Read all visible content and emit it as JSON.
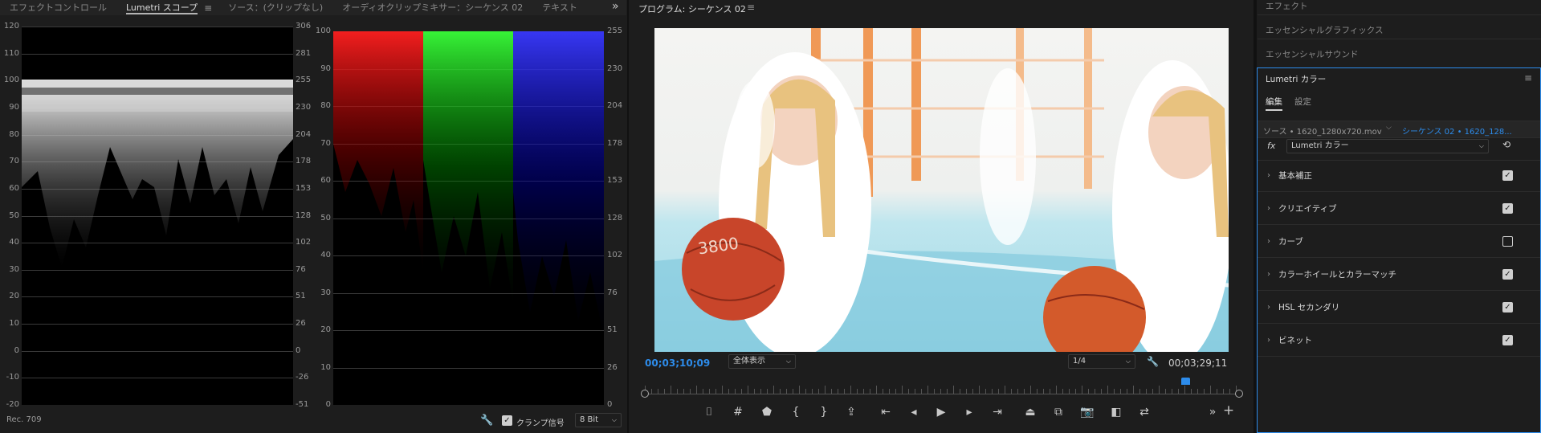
{
  "tabs": {
    "effect_controls": "エフェクトコントロール",
    "lumetri_scopes": "Lumetri スコープ",
    "source": "ソース：(クリップなし)",
    "audio_mixer": "オーディオクリップミキサー：シーケンス 02",
    "text": "テキスト",
    "more": "»",
    "menu": "≡"
  },
  "scope_left": {
    "left_labels": [
      "120",
      "110",
      "100",
      "90",
      "80",
      "70",
      "60",
      "50",
      "40",
      "30",
      "20",
      "10",
      "0",
      "-10",
      "-20"
    ],
    "right_labels": [
      "306",
      "281",
      "255",
      "230",
      "204",
      "178",
      "153",
      "128",
      "102",
      "76",
      "51",
      "26",
      "0",
      "-26",
      "-51"
    ],
    "color_space": "Rec. 709"
  },
  "scope_parade": {
    "left_labels": [
      "100",
      "90",
      "80",
      "70",
      "60",
      "50",
      "40",
      "30",
      "20",
      "10",
      "0"
    ],
    "right_labels": [
      "255",
      "230",
      "204",
      "178",
      "153",
      "128",
      "102",
      "76",
      "51",
      "26",
      "0"
    ]
  },
  "scope_footer": {
    "clamp_label": "クランプ信号",
    "bit_depth": "8 Bit"
  },
  "program": {
    "title": "プログラム: シーケンス 02",
    "timecode_current": "00;03;10;09",
    "timecode_duration": "00;03;29;11",
    "zoom": "全体表示",
    "resolution": "1/4",
    "playhead_fraction": 0.91,
    "ball_text": "3800"
  },
  "right_panel": {
    "effects": "エフェクト",
    "essential_graphics": "エッセンシャルグラフィックス",
    "essential_sound": "エッセンシャルサウンド",
    "lumetri_title": "Lumetri カラー",
    "sub_tabs": [
      "編集",
      "設定"
    ],
    "source_clip": "ソース • 1620_1280x720.mov",
    "sequence_clip": "シーケンス 02 • 1620_128...",
    "fx_label": "fx",
    "effect_select": "Lumetri カラー",
    "sections": [
      {
        "label": "基本補正",
        "checked": true
      },
      {
        "label": "クリエイティブ",
        "checked": true
      },
      {
        "label": "カーブ",
        "checked": false
      },
      {
        "label": "カラーホイールとカラーマッチ",
        "checked": true
      },
      {
        "label": "HSL セカンダリ",
        "checked": true
      },
      {
        "label": "ビネット",
        "checked": true
      }
    ]
  },
  "colors": {
    "accent": "#2d8ceb",
    "bg": "#1d1d1d"
  }
}
